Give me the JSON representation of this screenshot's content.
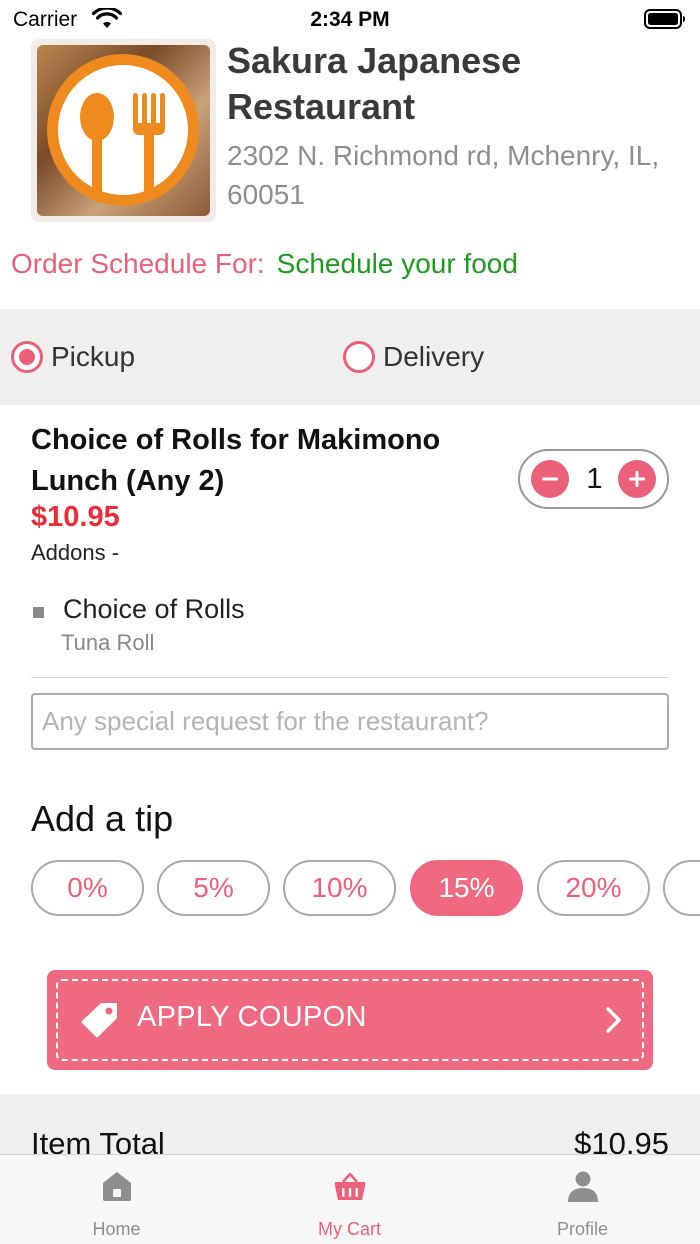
{
  "status_bar": {
    "carrier": "Carrier",
    "time": "2:34 PM",
    "icons": [
      "wifi-icon",
      "battery-icon"
    ]
  },
  "restaurant": {
    "name": "Sakura Japanese Restaurant",
    "address": "2302 N. Richmond rd, Mchenry, IL, 60051",
    "logo_icon": "spoon-fork-icon"
  },
  "schedule": {
    "label": "Order Schedule For:",
    "link": "Schedule your food"
  },
  "order_type": {
    "options": [
      {
        "label": "Pickup",
        "selected": true
      },
      {
        "label": "Delivery",
        "selected": false
      }
    ]
  },
  "cart_item": {
    "name": "Choice of Rolls for Makimono Lunch (Any 2)",
    "price": "$10.95",
    "addons_label": "Addons -",
    "quantity": "1",
    "addons": [
      {
        "name": "Choice of Rolls",
        "value": "Tuna Roll"
      }
    ]
  },
  "special_request": {
    "placeholder": "Any special request for the restaurant?",
    "value": ""
  },
  "tip": {
    "title": "Add a tip",
    "options": [
      "0%",
      "5%",
      "10%",
      "15%",
      "20%"
    ],
    "selected": "15%"
  },
  "coupon": {
    "label": "APPLY COUPON"
  },
  "totals": {
    "item_total_label": "Item Total",
    "item_total_value": "$10.95"
  },
  "tab_bar": {
    "tabs": [
      {
        "label": "Home",
        "icon": "home-icon",
        "active": false
      },
      {
        "label": "My Cart",
        "icon": "basket-icon",
        "active": true
      },
      {
        "label": "Profile",
        "icon": "profile-icon",
        "active": false
      }
    ]
  },
  "colors": {
    "accent": "#ef6a80",
    "price": "#ee2a39",
    "schedule_link": "#1f9a1f"
  }
}
